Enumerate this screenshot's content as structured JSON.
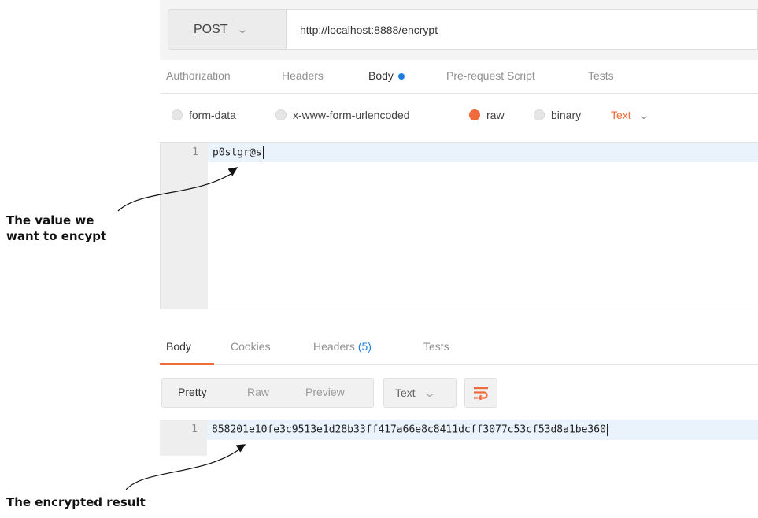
{
  "request": {
    "method": "POST",
    "url": "http://localhost:8888/encrypt"
  },
  "request_tabs": [
    {
      "label": "Authorization",
      "active": false
    },
    {
      "label": "Headers",
      "active": false
    },
    {
      "label": "Body",
      "active": true,
      "indicator_color": "#1a7fe0"
    },
    {
      "label": "Pre-request Script",
      "active": false
    },
    {
      "label": "Tests",
      "active": false
    }
  ],
  "body_types": [
    {
      "label": "form-data",
      "selected": false
    },
    {
      "label": "x-www-form-urlencoded",
      "selected": false
    },
    {
      "label": "raw",
      "selected": true
    },
    {
      "label": "binary",
      "selected": false
    }
  ],
  "raw_format": "Text",
  "request_editor": {
    "lines": [
      {
        "number": "1",
        "text": "p0stgr@s"
      }
    ]
  },
  "response_tabs": [
    {
      "label": "Body",
      "active": true
    },
    {
      "label": "Cookies",
      "active": false
    },
    {
      "label": "Headers",
      "count": "(5)",
      "active": false
    },
    {
      "label": "Tests",
      "active": false
    }
  ],
  "response_view": {
    "modes": [
      {
        "label": "Pretty",
        "active": true
      },
      {
        "label": "Raw",
        "active": false
      },
      {
        "label": "Preview",
        "active": false
      }
    ],
    "format": "Text",
    "wrap_icon": "wrap-lines-icon"
  },
  "response_editor": {
    "lines": [
      {
        "number": "1",
        "text": "858201e10fe3c9513e1d28b33ff417a66e8c8411dcff3077c53cf53d8a1be360"
      }
    ]
  },
  "annotations": {
    "value_callout": [
      "The value we",
      "want to encypt"
    ],
    "result_callout": "The encrypted result"
  },
  "colors": {
    "accent": "#f26b3a",
    "link_blue": "#1a7fe0"
  }
}
